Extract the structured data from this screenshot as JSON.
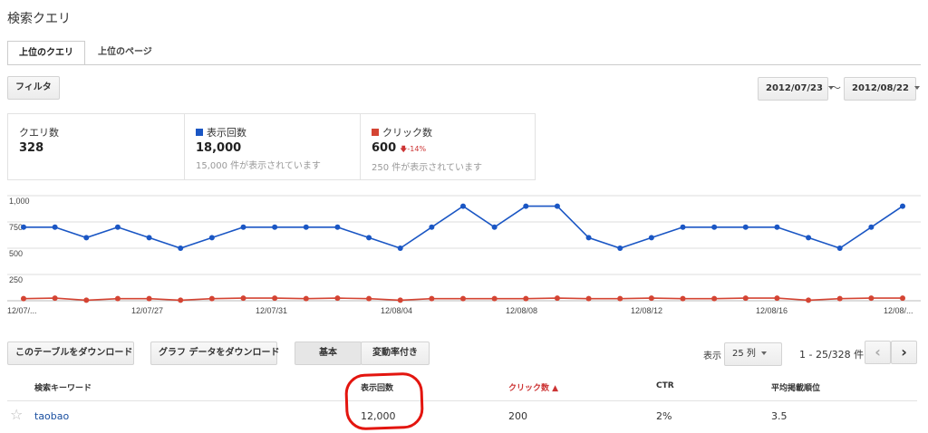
{
  "page": {
    "title": "検索クエリ"
  },
  "tabs": [
    {
      "label": "上位のクエリ",
      "active": true
    },
    {
      "label": "上位のページ",
      "active": false
    }
  ],
  "toolbar": {
    "filter_label": "フィルタ",
    "date_from": "2012/07/23",
    "date_sep": "〜",
    "date_to": "2012/08/22"
  },
  "stats": {
    "queries": {
      "label": "クエリ数",
      "value": "328"
    },
    "impressions": {
      "label": "表示回数",
      "value": "18,000",
      "sub": "15,000 件が表示されています",
      "color": "#1a56c4"
    },
    "clicks": {
      "label": "クリック数",
      "value": "600",
      "delta": "-14%",
      "sub": "250 件が表示されています",
      "color": "#d44433"
    }
  },
  "chart_data": {
    "type": "line",
    "x": [
      "12/07/23",
      "12/07/24",
      "12/07/25",
      "12/07/26",
      "12/07/27",
      "12/07/28",
      "12/07/29",
      "12/07/30",
      "12/07/31",
      "12/08/01",
      "12/08/02",
      "12/08/03",
      "12/08/04",
      "12/08/05",
      "12/08/06",
      "12/08/07",
      "12/08/08",
      "12/08/09",
      "12/08/10",
      "12/08/11",
      "12/08/12",
      "12/08/13",
      "12/08/14",
      "12/08/15",
      "12/08/16",
      "12/08/17",
      "12/08/18",
      "12/08/19",
      "12/08/20",
      "12/08/21"
    ],
    "x_tick_labels": [
      "12/07/...",
      "12/07/27",
      "12/07/31",
      "12/08/04",
      "12/08/08",
      "12/08/12",
      "12/08/16",
      "12/08/..."
    ],
    "series": [
      {
        "name": "表示回数",
        "color": "#1a56c4",
        "values": [
          700,
          700,
          600,
          700,
          600,
          500,
          600,
          700,
          700,
          700,
          700,
          600,
          500,
          700,
          900,
          700,
          900,
          900,
          600,
          500,
          600,
          700,
          700,
          700,
          700,
          600,
          500,
          700,
          900
        ]
      },
      {
        "name": "クリック数",
        "color": "#d44433",
        "values": [
          20,
          25,
          5,
          20,
          20,
          5,
          20,
          25,
          25,
          20,
          25,
          20,
          5,
          20,
          20,
          20,
          20,
          25,
          20,
          20,
          25,
          20,
          20,
          25,
          25,
          5,
          20,
          25,
          25
        ]
      }
    ],
    "y_ticks": [
      "1,000",
      "750",
      "500",
      "250"
    ],
    "ylim": [
      0,
      1000
    ],
    "grid": true
  },
  "table_controls": {
    "download_table": "このテーブルをダウンロード",
    "download_chart": "グラフ データをダウンロード",
    "toggle_basic": "基本",
    "toggle_change": "変動率付き",
    "show_label": "表示",
    "rows_value": "25 列",
    "range": "1 - 25/328 件"
  },
  "table": {
    "headers": {
      "keyword": "検索キーワード",
      "impressions": "表示回数",
      "clicks": "クリック数 ▲",
      "ctr": "CTR",
      "position": "平均掲載順位"
    },
    "rows": [
      {
        "star": "☆",
        "keyword": "taobao",
        "impressions": "12,000",
        "clicks": "200",
        "ctr": "2%",
        "position": "3.5"
      }
    ]
  }
}
